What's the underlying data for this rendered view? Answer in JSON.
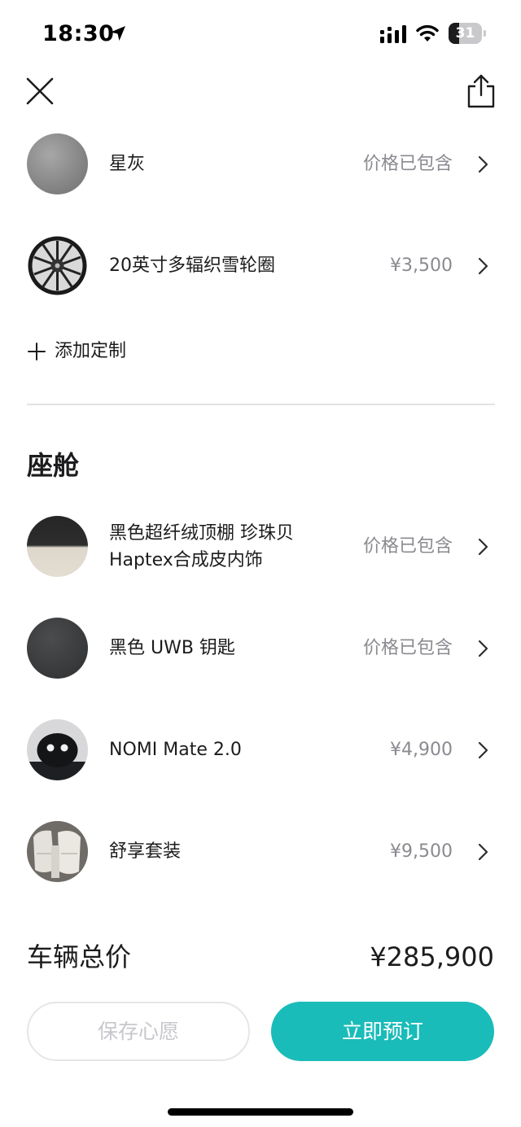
{
  "status_bar": {
    "time": "18:30",
    "battery_level": "31",
    "battery_fraction": 0.31
  },
  "exterior": {
    "items": [
      {
        "label": "星灰",
        "price": "价格已包含"
      },
      {
        "label": "20英寸多辐织雪轮圈",
        "price": "¥3,500"
      }
    ],
    "add_custom_label": "添加定制"
  },
  "cabin": {
    "title": "座舱",
    "items": [
      {
        "label_line1": "黑色超纤绒顶棚 珍珠贝",
        "label_line2": "Haptex合成皮内饰",
        "price": "价格已包含"
      },
      {
        "label": "黑色 UWB 钥匙",
        "price": "价格已包含"
      },
      {
        "label": "NOMI Mate 2.0",
        "price": "¥4,900"
      },
      {
        "label": "舒享套装",
        "price": "¥9,500"
      }
    ]
  },
  "summary": {
    "total_label": "车辆总价",
    "total_price": "¥285,900"
  },
  "actions": {
    "save_label": "保存心愿",
    "order_label": "立即预订"
  },
  "colors": {
    "accent": "#19bcb9",
    "muted_text": "#8a8a90",
    "star_grey": "#8e8e8e",
    "key_black": "#3a3c3e"
  },
  "icons": {
    "location": "location-arrow-icon",
    "signal": "cellular-signal-icon",
    "wifi": "wifi-icon",
    "close": "close-icon",
    "share": "share-icon",
    "chevron": "chevron-right-icon",
    "plus": "plus-icon"
  }
}
